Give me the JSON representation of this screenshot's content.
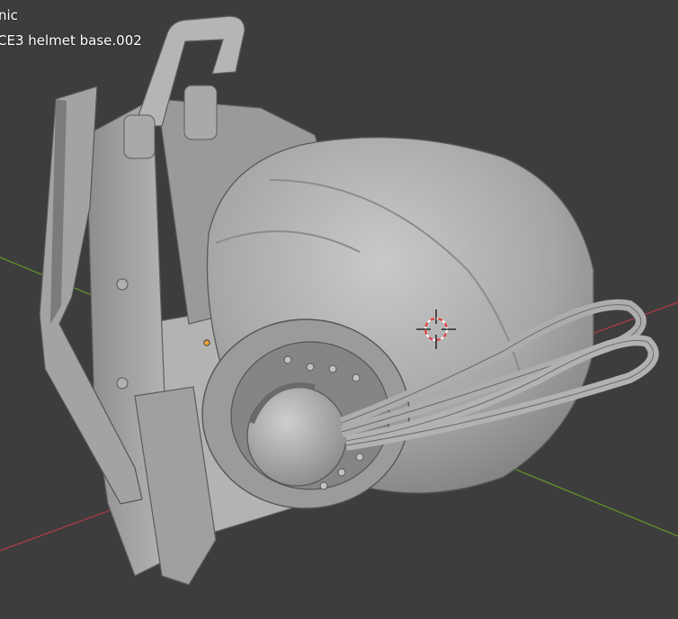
{
  "viewport": {
    "view_name": "nic",
    "object_name": "CE3 helmet base.002",
    "colors": {
      "background": "#3d3d3d",
      "axis_x": "#a83a45",
      "axis_y": "#5f8f2a",
      "mesh_light": "#b8b8b8",
      "mesh_mid": "#9c9c9c",
      "mesh_dark": "#6e6e6e",
      "cursor_red": "#e13b3b",
      "origin_orange": "#f2a23a"
    },
    "icons": {
      "cursor": "3d-cursor-icon",
      "origin": "object-origin-icon"
    }
  }
}
